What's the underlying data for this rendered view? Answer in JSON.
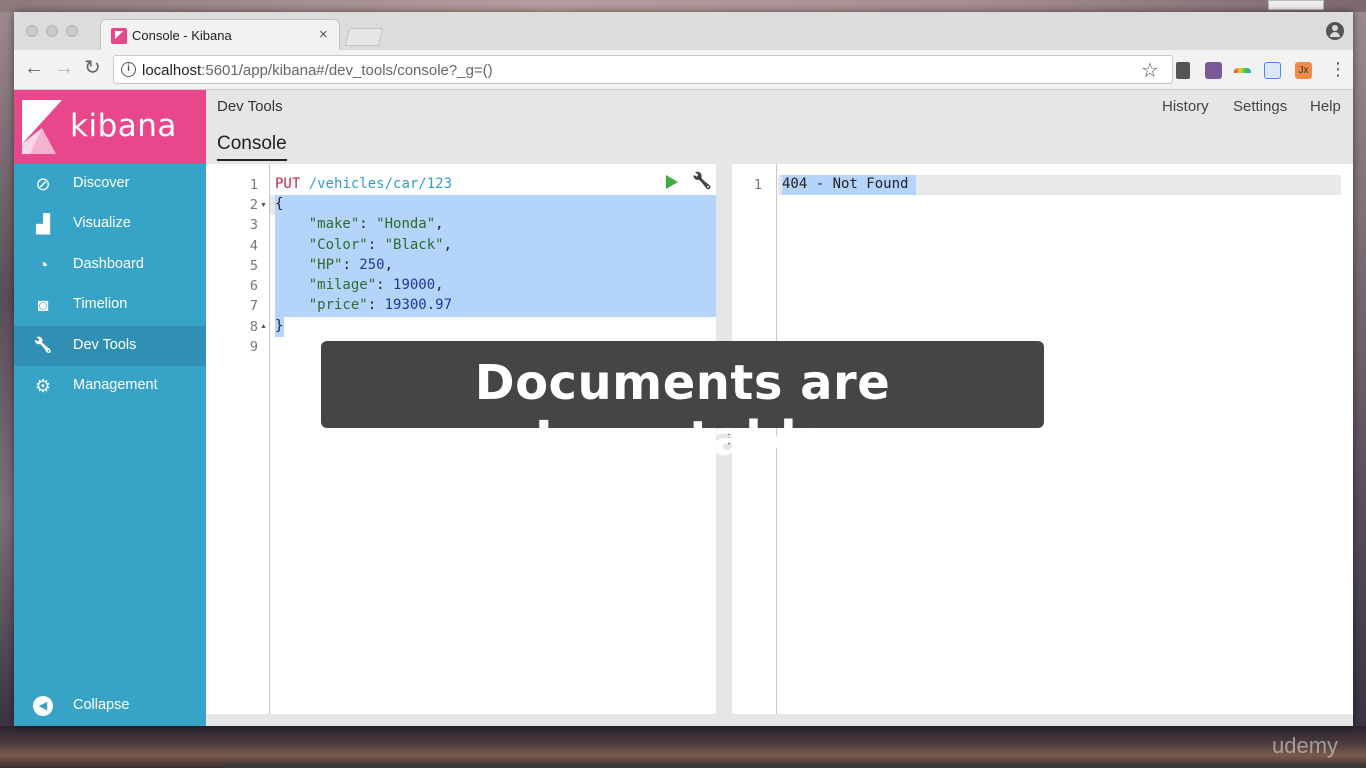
{
  "browser": {
    "tab_title": "Console - Kibana",
    "tab_close": "×",
    "url_host": "localhost",
    "url_rest": ":5601/app/kibana#/dev_tools/console?_g=()",
    "back_glyph": "←",
    "forward_glyph": "→",
    "reload_glyph": "↻",
    "star_glyph": "☆",
    "menu_glyph": "⋮",
    "info_glyph": "i",
    "extensions": [
      "robot-icon",
      "pillow-icon",
      "rainbow-icon",
      "translate-icon",
      "jx-icon"
    ],
    "ext_jx_label": "Jx"
  },
  "app": {
    "logo_text": "kibana",
    "brand_color": "#e8488b",
    "nav_color": "#36a3c7",
    "nav_items": [
      {
        "label": "Discover",
        "icon": "compass-icon",
        "glyph": "⊘"
      },
      {
        "label": "Visualize",
        "icon": "bar-chart-icon",
        "glyph": "▟"
      },
      {
        "label": "Dashboard",
        "icon": "gauge-icon",
        "glyph": "◔"
      },
      {
        "label": "Timelion",
        "icon": "timelion-icon",
        "glyph": "◙"
      },
      {
        "label": "Dev Tools",
        "icon": "wrench-icon",
        "glyph": "🔧"
      },
      {
        "label": "Management",
        "icon": "gear-icon",
        "glyph": "⚙"
      }
    ],
    "collapse": {
      "label": "Collapse",
      "glyph": "◀"
    },
    "active_nav": "Dev Tools"
  },
  "header": {
    "breadcrumb": "Dev Tools",
    "links": [
      "History",
      "Settings",
      "Help"
    ],
    "console_tab": "Console"
  },
  "editor": {
    "line_numbers": [
      "1",
      "2",
      "3",
      "4",
      "5",
      "6",
      "7",
      "8",
      "9"
    ],
    "method": "PUT",
    "path": "/vehicles/car/123",
    "open_brace": "{",
    "close_brace": "}",
    "fields": [
      {
        "key": "\"make\"",
        "value": "\"Honda\"",
        "trail": ",",
        "kind": "str"
      },
      {
        "key": "\"Color\"",
        "value": "\"Black\"",
        "trail": ",",
        "kind": "str"
      },
      {
        "key": "\"HP\"",
        "value": "250",
        "trail": ",",
        "kind": "num"
      },
      {
        "key": "\"milage\"",
        "value": "19000",
        "trail": ",",
        "kind": "num"
      },
      {
        "key": "\"price\"",
        "value": "19300.97",
        "trail": "",
        "kind": "num"
      }
    ],
    "wrench_glyph": "🔧",
    "divider_glyph": "⋮"
  },
  "output": {
    "line_number": "1",
    "text": "404 - Not Found"
  },
  "overlay": {
    "text": "Documents are Immutable"
  },
  "watermark": "udemy"
}
